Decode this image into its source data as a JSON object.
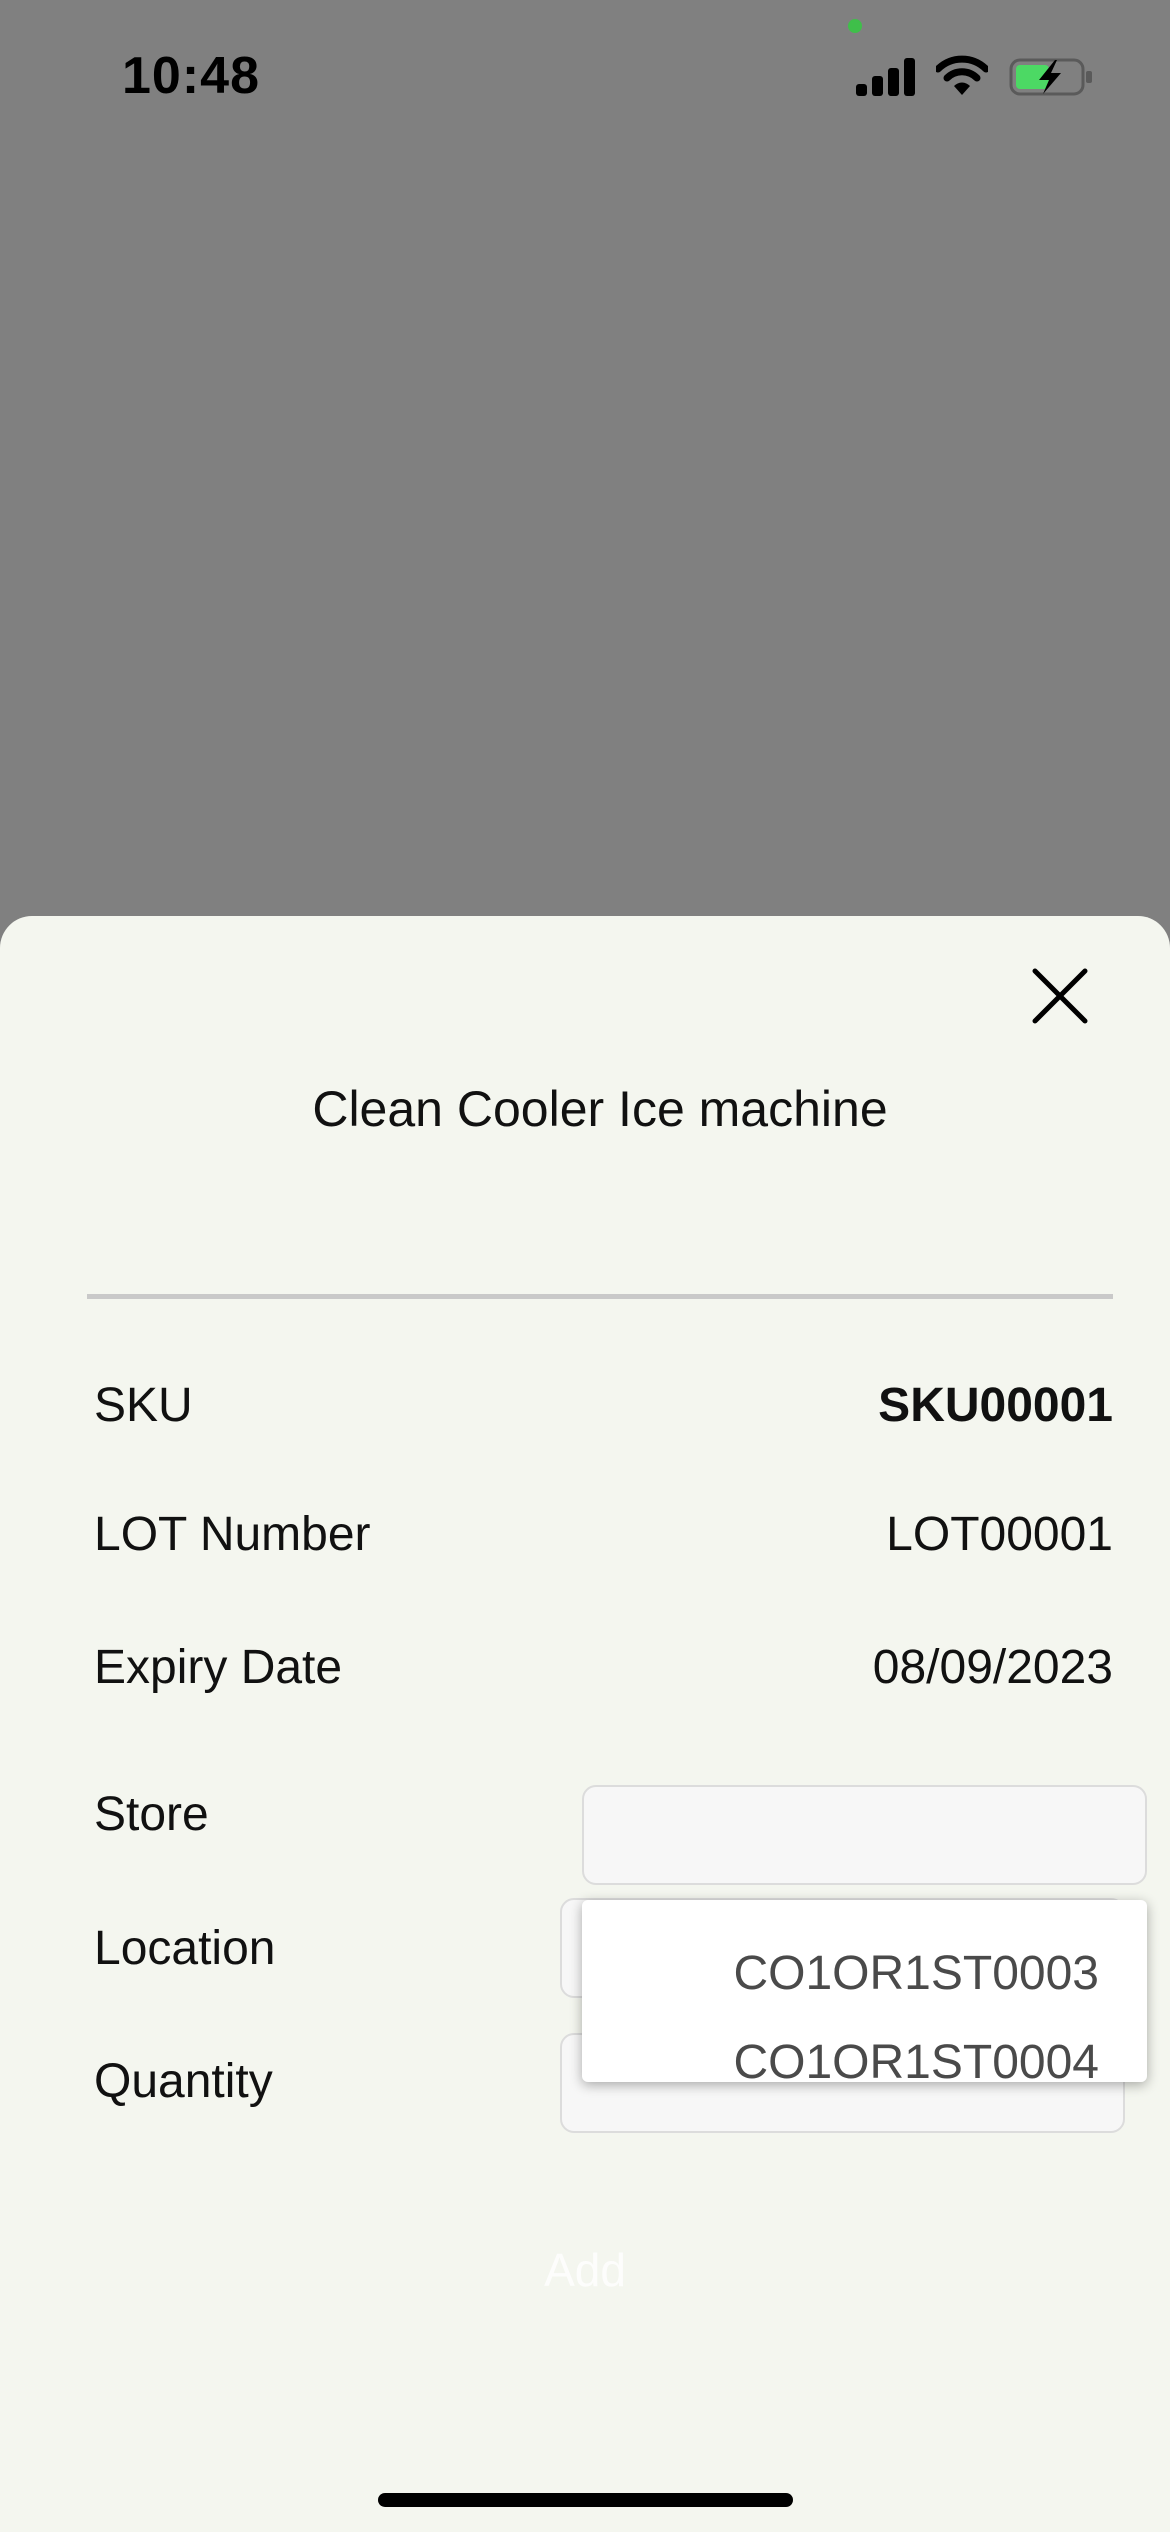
{
  "status_bar": {
    "time": "10:48"
  },
  "sheet": {
    "title": "Clean Cooler Ice machine",
    "rows": [
      {
        "label": "SKU",
        "value": "SKU00001"
      },
      {
        "label": "LOT Number",
        "value": "LOT00001"
      },
      {
        "label": "Expiry Date",
        "value": "08/09/2023"
      }
    ],
    "store": {
      "label": "Store",
      "value": ""
    },
    "location": {
      "label": "Location",
      "value": ""
    },
    "quantity": {
      "label": "Quantity",
      "value": ""
    },
    "location_options": [
      "CO1OR1ST0003",
      "CO1OR1ST0004"
    ],
    "add_label": "Add"
  },
  "icons": {
    "close": "close-icon",
    "signal": "cellular-signal-icon",
    "wifi": "wifi-icon",
    "battery": "battery-charging-icon"
  },
  "colors": {
    "backdrop": "#808080",
    "sheet_bg": "#f4f6ef",
    "battery_fill": "#4cd964",
    "camera_dot": "#3fbf4a"
  }
}
